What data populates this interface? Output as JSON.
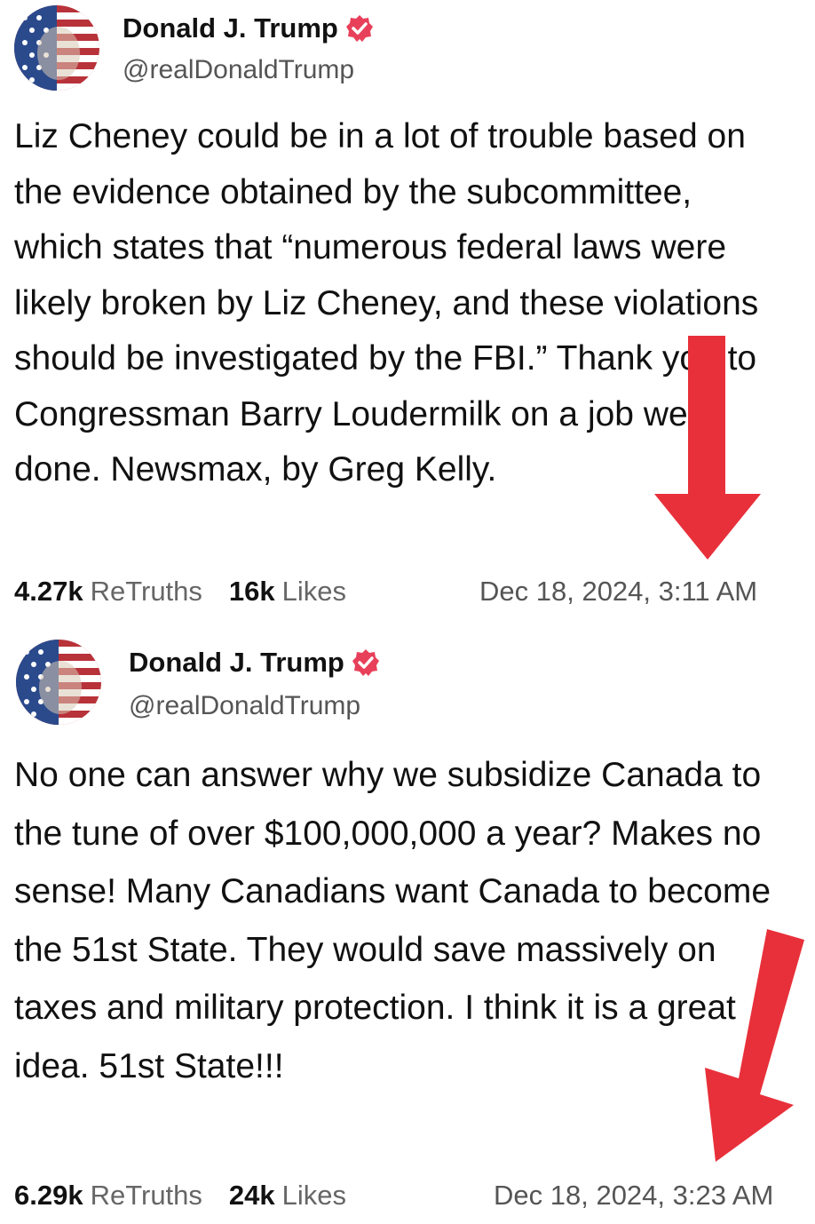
{
  "posts": [
    {
      "author": {
        "name": "Donald J. Trump",
        "handle": "@realDonaldTrump",
        "verified_icon": "verified-badge-icon"
      },
      "text": "Liz Cheney could be in a lot of trouble based on the evidence obtained by the subcommittee, which states that “numerous federal laws were likely broken by Liz Cheney, and these violations should be investigated by the FBI.” Thank you to Congressman Barry Loudermilk on a job well done. Newsmax, by Greg Kelly.",
      "stats": {
        "retruths_count": "4.27k",
        "retruths_label": "ReTruths",
        "likes_count": "16k",
        "likes_label": "Likes"
      },
      "timestamp": "Dec 18, 2024, 3:11 AM"
    },
    {
      "author": {
        "name": "Donald J. Trump",
        "handle": "@realDonaldTrump",
        "verified_icon": "verified-badge-icon"
      },
      "text": "No one can answer why we subsidize Canada to the tune of over $100,000,000 a year? Makes no sense! Many Canadians want Canada to become the 51st State. They would save massively on taxes and military protection. I think it is a great idea. 51st State!!!",
      "stats": {
        "retruths_count": "6.29k",
        "retruths_label": "ReTruths",
        "likes_count": "24k",
        "likes_label": "Likes"
      },
      "timestamp": "Dec 18, 2024, 3:23 AM"
    }
  ],
  "colors": {
    "arrow": "#e8303a",
    "verified_badge": "#e8405a",
    "text": "#111111",
    "muted": "#666666"
  }
}
